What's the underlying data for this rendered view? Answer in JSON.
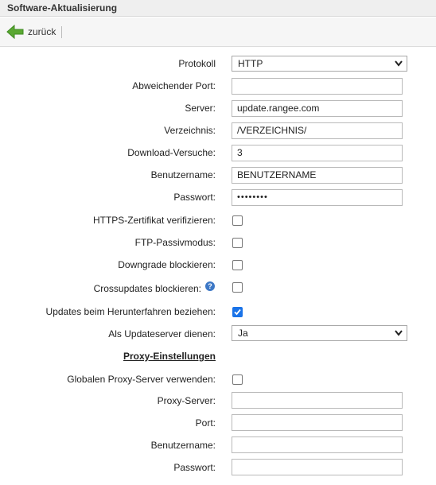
{
  "window": {
    "title": "Software-Aktualisierung"
  },
  "toolbar": {
    "back_label": "zurück"
  },
  "form": {
    "protokoll": {
      "label": "Protokoll",
      "value": "HTTP"
    },
    "port": {
      "label": "Abweichender Port:",
      "value": ""
    },
    "server": {
      "label": "Server:",
      "value": "update.rangee.com"
    },
    "verzeichnis": {
      "label": "Verzeichnis:",
      "value": "/VERZEICHNIS/"
    },
    "download": {
      "label": "Download-Versuche:",
      "value": "3"
    },
    "benutzername": {
      "label": "Benutzername:",
      "value": "BENUTZERNAME"
    },
    "passwort": {
      "label": "Passwort:",
      "value": "••••••••"
    },
    "https_verify": {
      "label": "HTTPS-Zertifikat verifizieren:",
      "checked": false
    },
    "ftp_passive": {
      "label": "FTP-Passivmodus:",
      "checked": false
    },
    "downgrade": {
      "label": "Downgrade blockieren:",
      "checked": false
    },
    "crossupdates": {
      "label": "Crossupdates blockieren:",
      "checked": false,
      "help": "?"
    },
    "shutdown_updates": {
      "label": "Updates beim Herunterfahren beziehen:",
      "checked": true
    },
    "updateserver": {
      "label": "Als Updateserver dienen:",
      "value": "Ja"
    }
  },
  "proxy": {
    "heading": "Proxy-Einstellungen",
    "global": {
      "label": "Globalen Proxy-Server verwenden:",
      "checked": false
    },
    "server": {
      "label": "Proxy-Server:",
      "value": ""
    },
    "port": {
      "label": "Port:",
      "value": ""
    },
    "benutzername": {
      "label": "Benutzername:",
      "value": ""
    },
    "passwort": {
      "label": "Passwort:",
      "value": ""
    }
  },
  "colors": {
    "accent": "#1a73e8",
    "back_arrow": "#5aa832",
    "help": "#3d78c6"
  }
}
